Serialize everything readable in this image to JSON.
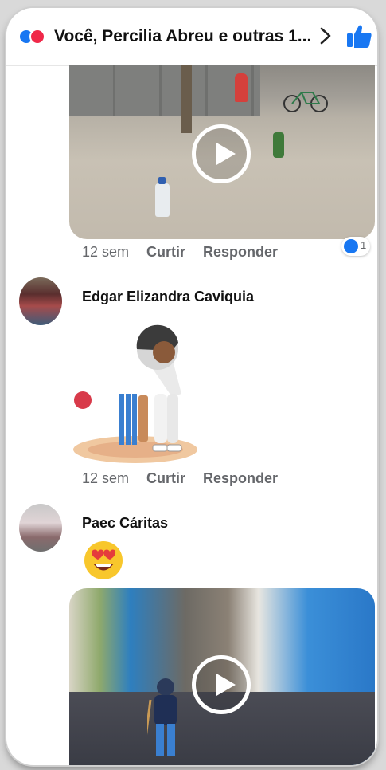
{
  "header": {
    "title": "Você, Percilia Abreu e outras 1..."
  },
  "comments": [
    {
      "media": "video",
      "time": "12 sem",
      "like_action": "Curtir",
      "reply_action": "Responder",
      "reaction_count": "1"
    },
    {
      "author": "Edgar Elizandra Caviquia",
      "media": "sticker",
      "time": "12 sem",
      "like_action": "Curtir",
      "reply_action": "Responder"
    },
    {
      "author": "Paec Cáritas",
      "media": "emoji-and-video"
    }
  ],
  "colors": {
    "fb_blue": "#1877f2",
    "love_red": "#f02849",
    "meta_gray": "#65676b"
  }
}
